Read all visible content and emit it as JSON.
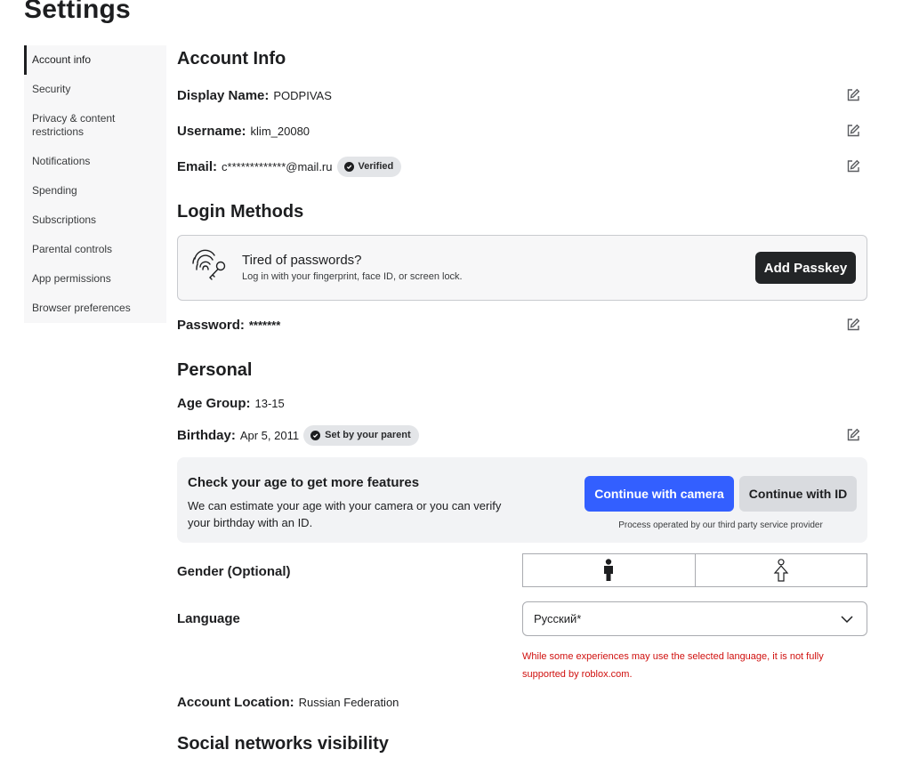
{
  "page": {
    "title": "Settings"
  },
  "sidebar": {
    "items": [
      {
        "label": "Account info",
        "active": true
      },
      {
        "label": "Security"
      },
      {
        "label": "Privacy & content restrictions"
      },
      {
        "label": "Notifications"
      },
      {
        "label": "Spending"
      },
      {
        "label": "Subscriptions"
      },
      {
        "label": "Parental controls"
      },
      {
        "label": "App permissions"
      },
      {
        "label": "Browser preferences"
      }
    ]
  },
  "account_info": {
    "title": "Account Info",
    "display_name": {
      "label": "Display Name:",
      "value": "PODPIVAS"
    },
    "username": {
      "label": "Username:",
      "value": "klim_20080"
    },
    "email": {
      "label": "Email:",
      "value": "c*************@mail.ru",
      "badge": "Verified"
    }
  },
  "login_methods": {
    "title": "Login Methods",
    "passkey": {
      "title": "Tired of passwords?",
      "subtitle": "Log in with your fingerprint, face ID, or screen lock.",
      "button": "Add Passkey"
    },
    "password": {
      "label": "Password:",
      "value": "*******"
    }
  },
  "personal": {
    "title": "Personal",
    "age_group": {
      "label": "Age Group:",
      "value": "13-15"
    },
    "birthday": {
      "label": "Birthday:",
      "value": "Apr 5, 2011",
      "badge": "Set by your parent"
    },
    "age_check": {
      "title": "Check your age to get more features",
      "description": "We can estimate your age with your camera or you can verify your birthday with an ID.",
      "camera_button": "Continue with camera",
      "id_button": "Continue with ID",
      "note": "Process operated by our third party service provider"
    },
    "gender": {
      "label": "Gender (Optional)"
    },
    "language": {
      "label": "Language",
      "selected": "Русский*",
      "warning": "While some experiences may use the selected language, it is not fully supported by roblox.com."
    },
    "account_location": {
      "label": "Account Location:",
      "value": "Russian Federation"
    }
  },
  "social": {
    "title": "Social networks visibility"
  },
  "colors": {
    "accent": "#335fff",
    "warning": "#d0100e",
    "dark_button": "#232527"
  },
  "icons": [
    "edit-icon",
    "fingerprint-key-icon",
    "check-circle-icon",
    "male-icon",
    "female-icon",
    "chevron-down-icon"
  ]
}
